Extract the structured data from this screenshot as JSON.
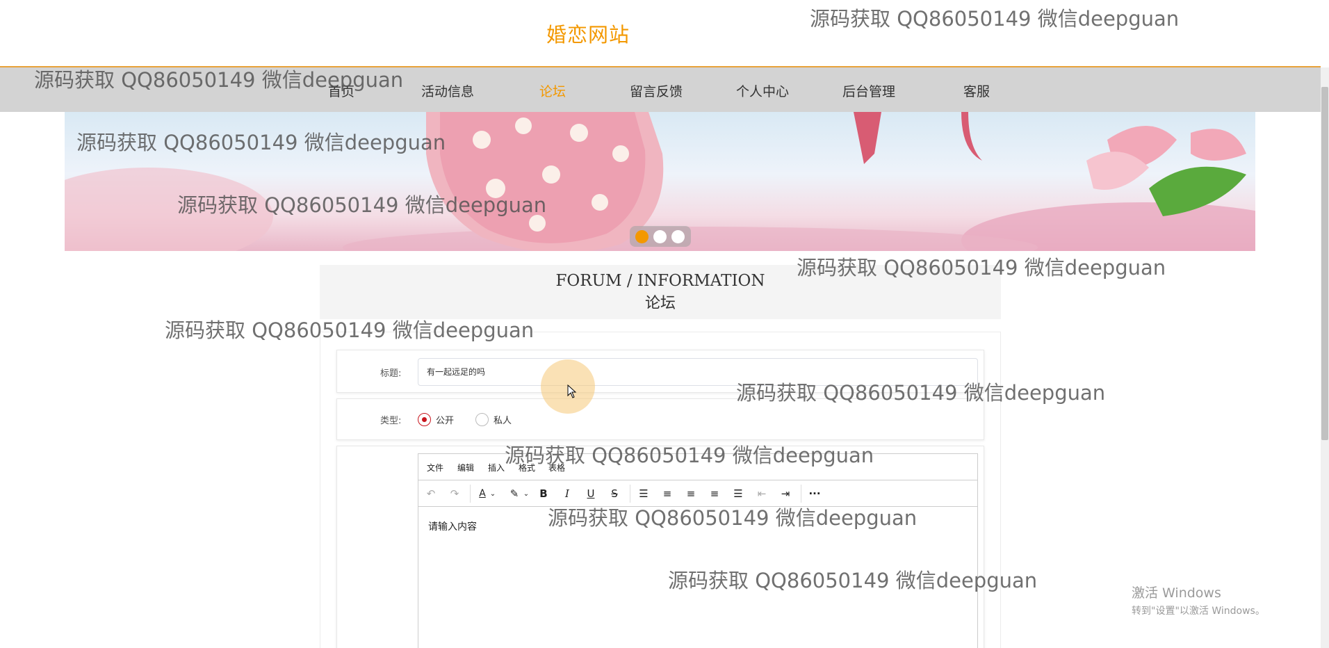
{
  "site": {
    "title": "婚恋网站"
  },
  "nav": {
    "items": [
      {
        "label": "首页",
        "active": false
      },
      {
        "label": "活动信息",
        "active": false
      },
      {
        "label": "论坛",
        "active": true
      },
      {
        "label": "留言反馈",
        "active": false
      },
      {
        "label": "个人中心",
        "active": false
      },
      {
        "label": "后台管理",
        "active": false
      },
      {
        "label": "客服",
        "active": false
      }
    ]
  },
  "banner": {
    "slides": 3,
    "active_slide": 1
  },
  "section": {
    "title_en": "FORUM / INFORMATION",
    "title_cn": "论坛"
  },
  "form": {
    "title_label": "标题:",
    "title_value": "有一起远足的吗",
    "type_label": "类型:",
    "type_options": [
      {
        "label": "公开",
        "checked": true
      },
      {
        "label": "私人",
        "checked": false
      }
    ]
  },
  "editor": {
    "menus": [
      "文件",
      "编辑",
      "插入",
      "格式",
      "表格"
    ],
    "tools": [
      "undo-icon",
      "redo-icon",
      "text-color-icon",
      "highlight-icon",
      "bold-icon",
      "italic-icon",
      "underline-icon",
      "strikethrough-icon",
      "list-icon",
      "align-left-icon",
      "align-center-icon",
      "align-right-icon",
      "justify-icon",
      "outdent-icon",
      "indent-icon",
      "more-icon"
    ],
    "placeholder": "请输入内容"
  },
  "watermark": {
    "text": "源码获取 QQ86050149 微信deepguan"
  },
  "os_notice": {
    "line1": "激活 Windows",
    "line2": "转到\"设置\"以激活 Windows。"
  },
  "colors": {
    "accent": "#f39800",
    "nav_bg": "#d3d3d3",
    "radio_checked": "#c8161e"
  }
}
